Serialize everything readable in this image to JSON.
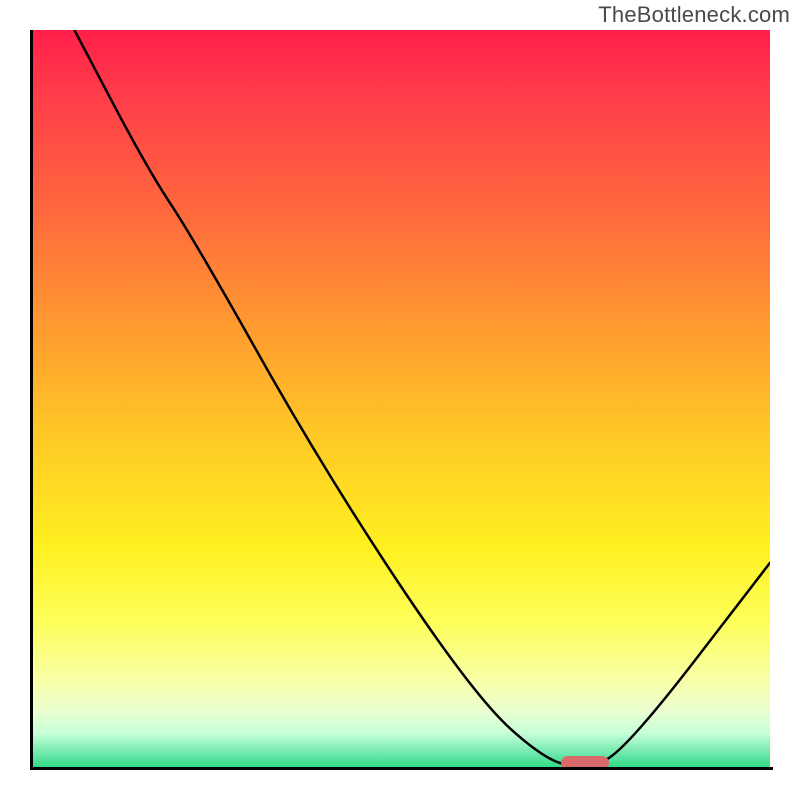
{
  "watermark": "TheBottleneck.com",
  "chart_data": {
    "type": "line",
    "title": "",
    "xlabel": "",
    "ylabel": "",
    "xlim": [
      0,
      100
    ],
    "ylim": [
      0,
      100
    ],
    "grid": false,
    "legend": false,
    "background_gradient": {
      "top": "#ff1f4a",
      "middle": "#fff020",
      "bottom": "#24d67a"
    },
    "series": [
      {
        "name": "bottleneck-curve",
        "x": [
          6,
          16,
          22,
          40,
          60,
          70,
          75,
          80,
          100
        ],
        "y": [
          100,
          81,
          72,
          40,
          10,
          1,
          0.5,
          2,
          28
        ],
        "stroke": "#000000",
        "stroke_width": 2.5
      }
    ],
    "markers": [
      {
        "name": "optimal-zone",
        "x": 75,
        "y": 0.5,
        "color": "#d86a6a",
        "shape": "pill"
      }
    ]
  }
}
